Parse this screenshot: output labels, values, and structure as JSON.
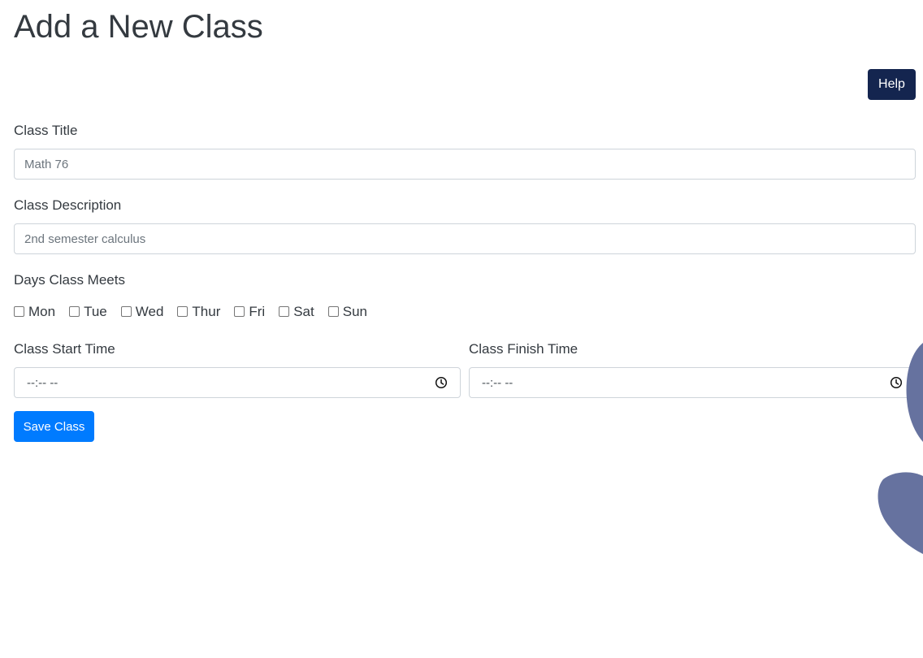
{
  "page": {
    "title": "Add a New Class"
  },
  "help_button": {
    "label": "Help"
  },
  "class_title": {
    "label": "Class Title",
    "placeholder": "Math 76"
  },
  "class_description": {
    "label": "Class Description",
    "placeholder": "2nd semester calculus"
  },
  "days": {
    "label": "Days Class Meets",
    "options": [
      {
        "label": "Mon",
        "checked": false
      },
      {
        "label": "Tue",
        "checked": false
      },
      {
        "label": "Wed",
        "checked": false
      },
      {
        "label": "Thur",
        "checked": false
      },
      {
        "label": "Fri",
        "checked": false
      },
      {
        "label": "Sat",
        "checked": false
      },
      {
        "label": "Sun",
        "checked": false
      }
    ]
  },
  "start_time": {
    "label": "Class Start Time",
    "value": "--:-- --"
  },
  "finish_time": {
    "label": "Class Finish Time",
    "value": "--:-- --"
  },
  "save_button": {
    "label": "Save Class"
  },
  "colors": {
    "help_button": "#14254f",
    "save_button": "#007bff",
    "decoration_blob": "#66729f"
  }
}
